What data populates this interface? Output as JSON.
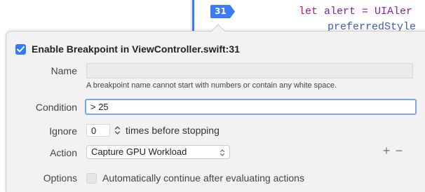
{
  "editor": {
    "line_number": "31",
    "code_line_1_keyword": "let",
    "code_line_1_rest": " alert = UIAler",
    "code_line_2": "preferredStyle"
  },
  "popover": {
    "enable_label": "Enable Breakpoint in ViewController.swift:31",
    "enable_checked": true,
    "name": {
      "label": "Name",
      "value": "",
      "hint": "A breakpoint name cannot start with numbers or contain any white space."
    },
    "condition": {
      "label": "Condition",
      "value": "> 25"
    },
    "ignore": {
      "label": "Ignore",
      "value": "0",
      "suffix": "times before stopping"
    },
    "action": {
      "label": "Action",
      "selected": "Capture GPU Workload",
      "add_label": "+",
      "remove_label": "−"
    },
    "options": {
      "label": "Options",
      "checkbox_label": "Automatically continue after evaluating actions",
      "checked": false
    }
  },
  "colors": {
    "accent": "#2f7bf5",
    "gutter": "#3b7cf4",
    "keyword": "#b3138f"
  }
}
